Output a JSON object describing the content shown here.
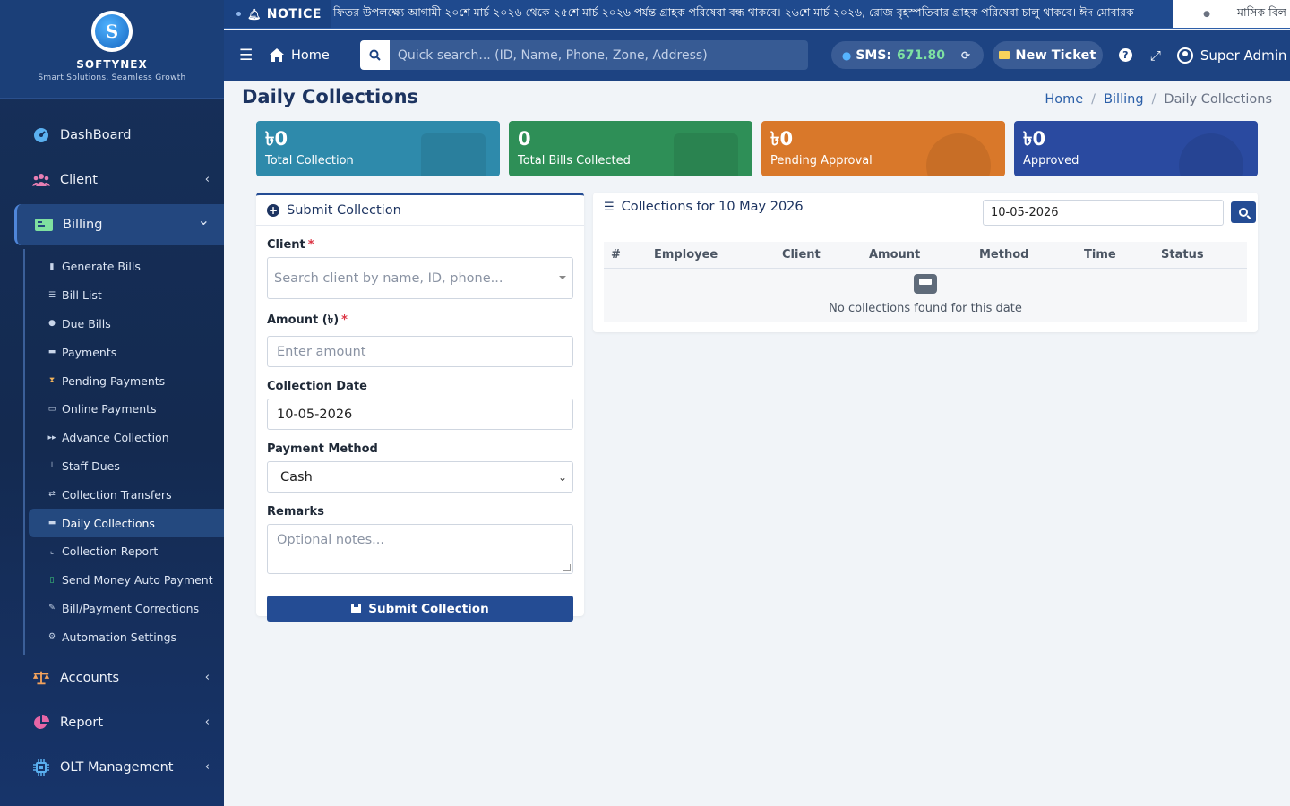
{
  "brand": {
    "logo_letter": "S",
    "name": "SOFTYNEX",
    "tagline": "Smart Solutions. Seamless Growth"
  },
  "sidebar": {
    "main": [
      {
        "label": "DashBoard",
        "icon": "dashboard-gauge-icon"
      },
      {
        "label": "Client",
        "icon": "users-icon",
        "chevron": "‹"
      },
      {
        "label": "Billing",
        "icon": "money-bill-icon",
        "chevron": "⌄"
      }
    ],
    "billing_items": [
      {
        "label": "Generate Bills",
        "icon": "file-icon"
      },
      {
        "label": "Bill List",
        "icon": "list-icon"
      },
      {
        "label": "Due Bills",
        "icon": "exclamation-circle-icon"
      },
      {
        "label": "Payments",
        "icon": "money-icon"
      },
      {
        "label": "Pending Payments",
        "icon": "hourglass-icon"
      },
      {
        "label": "Online Payments",
        "icon": "credit-card-icon"
      },
      {
        "label": "Advance Collection",
        "icon": "fast-forward-icon"
      },
      {
        "label": "Staff Dues",
        "icon": "hand-holding-icon"
      },
      {
        "label": "Collection Transfers",
        "icon": "exchange-icon"
      },
      {
        "label": "Daily Collections",
        "icon": "money-icon"
      },
      {
        "label": "Collection Report",
        "icon": "chart-line-icon"
      },
      {
        "label": "Send Money Auto Payment",
        "icon": "mobile-icon"
      },
      {
        "label": "Bill/Payment Corrections",
        "icon": "edit-icon"
      },
      {
        "label": "Automation Settings",
        "icon": "cogs-icon"
      }
    ],
    "bottom": [
      {
        "label": "Accounts",
        "icon": "balance-scale-icon",
        "chevron": "‹"
      },
      {
        "label": "Report",
        "icon": "pie-chart-icon",
        "chevron": "‹"
      },
      {
        "label": "OLT Management",
        "icon": "microchip-icon",
        "chevron": "‹"
      }
    ]
  },
  "notice": {
    "label": "NOTICE",
    "text": "ফিতর উপলক্ষ্যে আগামী ২০শে মার্চ ২০২৬ থেকে ২৫শে মার্চ ২০২৬ পর্যন্ত গ্রাহক পরিষেবা বন্ধ থাকবে। ২৬শে মার্চ ২০২৬, রোজ বৃহস্পতিবার গ্রাহক পরিষেবা চালু থাকবে। ঈদ মোবারক",
    "separator": "●",
    "trailing": "মাসিক বিল"
  },
  "topbar": {
    "home": "Home",
    "search_placeholder": "Quick search... (ID, Name, Phone, Zone, Address)",
    "sms_label": "SMS:",
    "sms_value": "671.80",
    "ticket": "New Ticket",
    "admin": "Super Admin"
  },
  "page": {
    "title": "Daily Collections",
    "breadcrumb": [
      "Home",
      "Billing",
      "Daily Collections"
    ]
  },
  "stats": [
    {
      "value": "৳0",
      "label": "Total Collection",
      "color": "#2e8aab"
    },
    {
      "value": "0",
      "label": "Total Bills Collected",
      "color": "#2e8f57"
    },
    {
      "value": "৳0",
      "label": "Pending Approval",
      "color": "#d9782a"
    },
    {
      "value": "৳0",
      "label": "Approved",
      "color": "#2a4aa0"
    }
  ],
  "form": {
    "title": "Submit Collection",
    "client_label": "Client",
    "client_placeholder": "Search client by name, ID, phone...",
    "amount_label": "Amount (৳)",
    "amount_placeholder": "Enter amount",
    "date_label": "Collection Date",
    "date_value": "10-05-2026",
    "method_label": "Payment Method",
    "method_value": "Cash",
    "remarks_label": "Remarks",
    "remarks_placeholder": "Optional notes...",
    "submit": "Submit Collection",
    "required_mark": "*"
  },
  "collections": {
    "title": "Collections for 10 May 2026",
    "date_value": "10-05-2026",
    "columns": [
      "#",
      "Employee",
      "Client",
      "Amount",
      "Method",
      "Time",
      "Status"
    ],
    "empty_text": "No collections found for this date"
  }
}
